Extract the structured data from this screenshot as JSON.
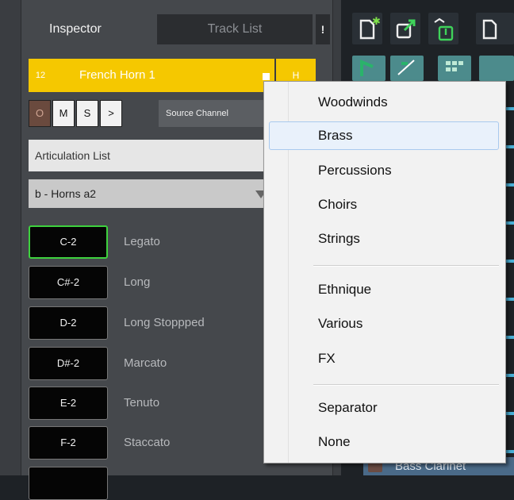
{
  "inspector": {
    "tab_inspector": "Inspector",
    "tab_tracklist": "Track List",
    "tab_bang": "!",
    "track_number": "12",
    "track_name": "French Horn 1",
    "track_h": "H",
    "buttons": {
      "o": "O",
      "m": "M",
      "s": "S",
      "g": ">"
    },
    "source_channel": "Source Channel",
    "articulation_list_label": "Articulation List",
    "preset_value": "b - Horns a2",
    "articulations": [
      {
        "key": "C-2",
        "label": "Legato",
        "active": true
      },
      {
        "key": "C#-2",
        "label": "Long",
        "active": false
      },
      {
        "key": "D-2",
        "label": "Long Stoppped",
        "active": false
      },
      {
        "key": "D#-2",
        "label": "Marcato",
        "active": false
      },
      {
        "key": "E-2",
        "label": "Tenuto",
        "active": false
      },
      {
        "key": "F-2",
        "label": "Staccato",
        "active": false
      }
    ]
  },
  "tracks": {
    "bottom_track": "Bass Clarinet"
  },
  "menu": {
    "items": [
      "Woodwinds",
      "Brass",
      "Percussions",
      "Choirs",
      "Strings",
      "Ethnique",
      "Various",
      "FX",
      "Separator",
      "None"
    ],
    "selected": "Brass"
  },
  "colors": {
    "track_yellow": "#f5c800",
    "active_green": "#3ed13e",
    "menu_highlight": "#e9f1fb"
  },
  "icons": [
    "new-track-icon",
    "export-icon",
    "import-icon",
    "note-icon",
    "wrench-icon",
    "grid-icon"
  ]
}
